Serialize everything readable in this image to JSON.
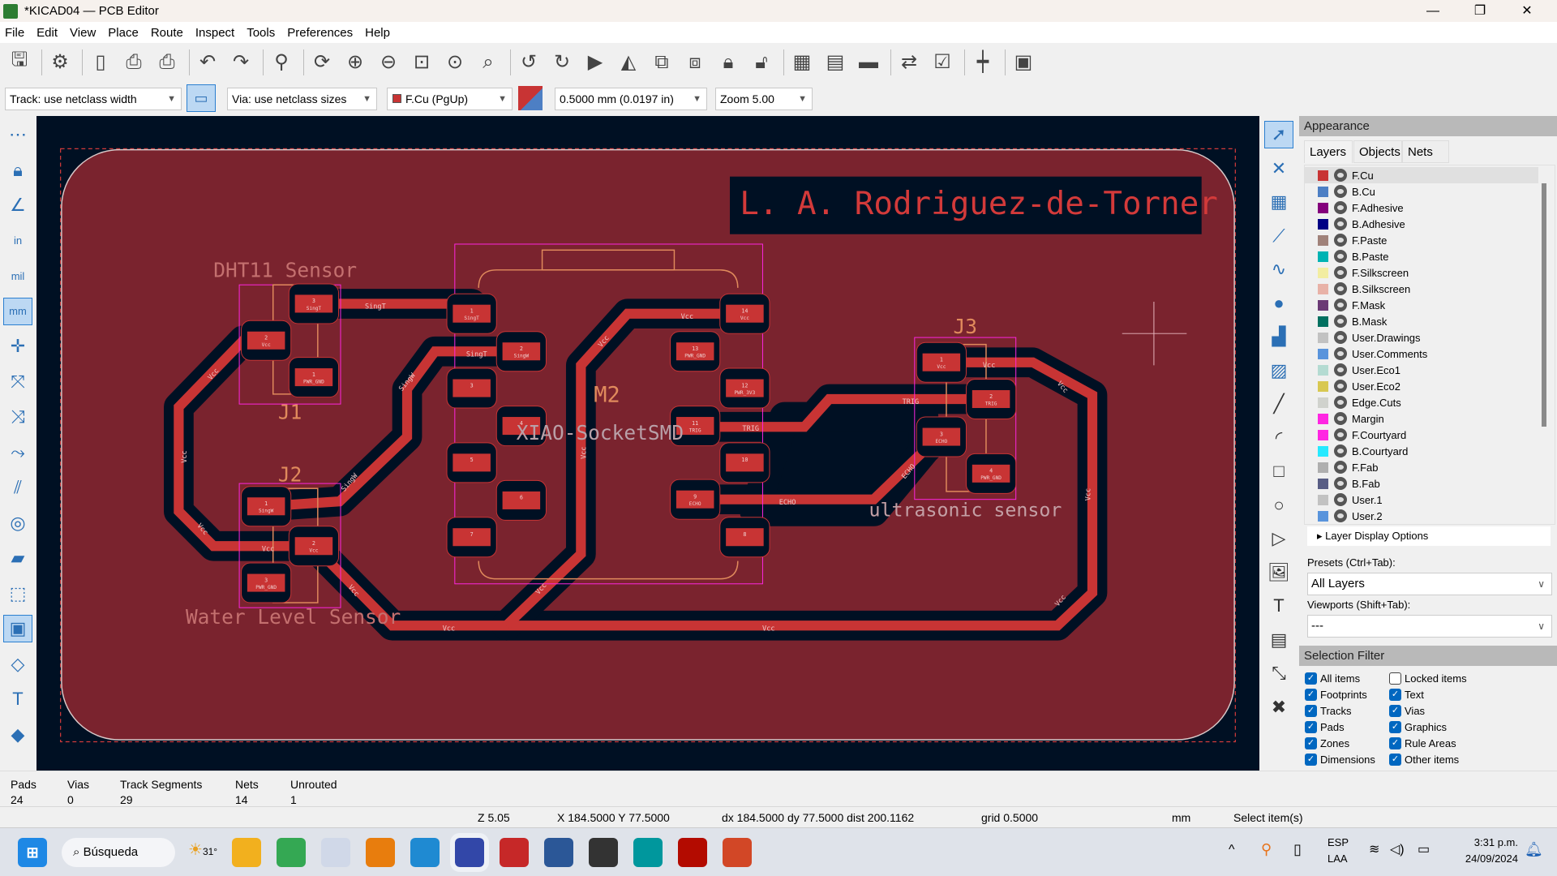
{
  "window": {
    "title": "*KICAD04 — PCB Editor",
    "controls": [
      "minimize",
      "restore",
      "close"
    ]
  },
  "menu": [
    "File",
    "Edit",
    "View",
    "Place",
    "Route",
    "Inspect",
    "Tools",
    "Preferences",
    "Help"
  ],
  "toolbar": [
    "save",
    "board-setup",
    "page-settings",
    "print",
    "plot",
    "undo",
    "redo",
    "find",
    "redraw",
    "zoom-in",
    "zoom-out",
    "zoom-fit",
    "zoom-objects",
    "zoom-selection",
    "rotate-ccw",
    "rotate-cw",
    "flip",
    "mirror",
    "group",
    "ungroup",
    "lock",
    "unlock",
    "netlist",
    "footprint-library",
    "footprint-editor",
    "update-pcb",
    "drc",
    "router",
    "scripting-console"
  ],
  "toolbar2": {
    "track": "Track: use netclass width",
    "via": "Via: use netclass sizes",
    "layer": "F.Cu (PgUp)",
    "layer_color": "#c83434",
    "grid": "0.5000 mm (0.0197 in)",
    "zoom": "Zoom 5.00"
  },
  "left_toolbar": [
    "grid",
    "lock-overrides",
    "polar-coordinates",
    "inches",
    "mils",
    "millimeters",
    "cursor",
    "ratsnest",
    "curved-ratsnest",
    "net-highlight",
    "track-outline",
    "via-outline",
    "zone-fill",
    "zone-outline",
    "pad-outline",
    "graphic-outline",
    "text-outline",
    "layer-contrast"
  ],
  "right_toolbar": [
    "select",
    "local-ratsnest",
    "add-footprint",
    "route-track",
    "tune-length",
    "add-via",
    "add-zone",
    "add-rule-area",
    "draw-line",
    "draw-arc",
    "draw-rectangle",
    "draw-circle",
    "draw-polygon",
    "add-image",
    "add-text",
    "add-textbox",
    "add-dimension",
    "delete"
  ],
  "pcb": {
    "title_text": "L. A. Rodriguez-de-Torner",
    "labels": {
      "dht11": "DHT11 Sensor",
      "j1": "J1",
      "j2": "J2",
      "water": "Water Level Sensor",
      "m2": "M2",
      "xiao": "XIAO-SocketSMD",
      "j3": "J3",
      "ultra": "ultrasonic sensor"
    },
    "track_labels": [
      "SingT",
      "SingW",
      "SingW",
      "SingW",
      "Vcc",
      "Vcc",
      "Vcc",
      "Vcc",
      "Vcc",
      "Vcc",
      "Vcc",
      "Vcc",
      "Vcc",
      "TRIG",
      "TRIG",
      "ECHO",
      "ECHO"
    ],
    "pads": [
      {
        "ref": "J1",
        "num": "3",
        "net": "SingT"
      },
      {
        "ref": "J1",
        "num": "2",
        "net": "Vcc"
      },
      {
        "ref": "J1",
        "num": "1",
        "net": "PWR_GND"
      },
      {
        "ref": "J2",
        "num": "1",
        "net": "SingW"
      },
      {
        "ref": "J2",
        "num": "2",
        "net": "Vcc"
      },
      {
        "ref": "J2",
        "num": "3",
        "net": "PWR_GND"
      },
      {
        "ref": "M2",
        "num": "1",
        "net": "SingT"
      },
      {
        "ref": "M2",
        "num": "2",
        "net": "SingW"
      },
      {
        "ref": "M2",
        "num": "3",
        "net": ""
      },
      {
        "ref": "M2",
        "num": "4",
        "net": ""
      },
      {
        "ref": "M2",
        "num": "5",
        "net": ""
      },
      {
        "ref": "M2",
        "num": "6",
        "net": ""
      },
      {
        "ref": "M2",
        "num": "7",
        "net": ""
      },
      {
        "ref": "M2",
        "num": "8",
        "net": ""
      },
      {
        "ref": "M2",
        "num": "9",
        "net": "ECHO"
      },
      {
        "ref": "M2",
        "num": "10",
        "net": ""
      },
      {
        "ref": "M2",
        "num": "11",
        "net": "TRIG"
      },
      {
        "ref": "M2",
        "num": "12",
        "net": "PWR_3V3"
      },
      {
        "ref": "M2",
        "num": "13",
        "net": "PWR_GND"
      },
      {
        "ref": "M2",
        "num": "14",
        "net": "Vcc"
      },
      {
        "ref": "J3",
        "num": "1",
        "net": "Vcc"
      },
      {
        "ref": "J3",
        "num": "2",
        "net": "TRIG"
      },
      {
        "ref": "J3",
        "num": "3",
        "net": "ECHO"
      },
      {
        "ref": "J3",
        "num": "4",
        "net": "PWR_GND"
      }
    ],
    "colors": {
      "board": "#7a232e",
      "copper": "#c83434",
      "background": "#001023",
      "courtyard": "#ff26e2",
      "fab": "#e08a5c",
      "silk": "#f2eda1"
    }
  },
  "appearance": {
    "title": "Appearance",
    "tabs": [
      "Layers",
      "Objects",
      "Nets"
    ],
    "active_tab": "Layers",
    "layers": [
      {
        "name": "F.Cu",
        "color": "#c83434"
      },
      {
        "name": "B.Cu",
        "color": "#4d7fc4"
      },
      {
        "name": "F.Adhesive",
        "color": "#84007c"
      },
      {
        "name": "B.Adhesive",
        "color": "#000084"
      },
      {
        "name": "F.Paste",
        "color": "#a0827a"
      },
      {
        "name": "B.Paste",
        "color": "#00b3b3"
      },
      {
        "name": "F.Silkscreen",
        "color": "#f2eda1"
      },
      {
        "name": "B.Silkscreen",
        "color": "#e8b2a7"
      },
      {
        "name": "F.Mask",
        "color": "#6b3a75"
      },
      {
        "name": "B.Mask",
        "color": "#027060"
      },
      {
        "name": "User.Drawings",
        "color": "#c2c2c2"
      },
      {
        "name": "User.Comments",
        "color": "#5994dc"
      },
      {
        "name": "User.Eco1",
        "color": "#b4dbd2"
      },
      {
        "name": "User.Eco2",
        "color": "#d8c852"
      },
      {
        "name": "Edge.Cuts",
        "color": "#d0d2cd"
      },
      {
        "name": "Margin",
        "color": "#ff26e2"
      },
      {
        "name": "F.Courtyard",
        "color": "#ff26e2"
      },
      {
        "name": "B.Courtyard",
        "color": "#26e9ff"
      },
      {
        "name": "F.Fab",
        "color": "#afafaf"
      },
      {
        "name": "B.Fab",
        "color": "#585d84"
      },
      {
        "name": "User.1",
        "color": "#c2c2c2"
      },
      {
        "name": "User.2",
        "color": "#5994dc"
      }
    ],
    "active_layer": "F.Cu",
    "layer_display_options": "Layer Display Options",
    "presets_label": "Presets (Ctrl+Tab):",
    "presets_value": "All Layers",
    "viewports_label": "Viewports (Shift+Tab):",
    "viewports_value": "---"
  },
  "selection_filter": {
    "title": "Selection Filter",
    "items": [
      {
        "label": "All items",
        "checked": true
      },
      {
        "label": "Locked items",
        "checked": false
      },
      {
        "label": "Footprints",
        "checked": true
      },
      {
        "label": "Text",
        "checked": true
      },
      {
        "label": "Tracks",
        "checked": true
      },
      {
        "label": "Vias",
        "checked": true
      },
      {
        "label": "Pads",
        "checked": true
      },
      {
        "label": "Graphics",
        "checked": true
      },
      {
        "label": "Zones",
        "checked": true
      },
      {
        "label": "Rule Areas",
        "checked": true
      },
      {
        "label": "Dimensions",
        "checked": true
      },
      {
        "label": "Other items",
        "checked": true
      }
    ]
  },
  "stats": [
    {
      "label": "Pads",
      "value": "24"
    },
    {
      "label": "Vias",
      "value": "0"
    },
    {
      "label": "Track Segments",
      "value": "29"
    },
    {
      "label": "Nets",
      "value": "14"
    },
    {
      "label": "Unrouted",
      "value": "1"
    }
  ],
  "statusbar": {
    "zoom": "Z 5.05",
    "coords": "X 184.5000  Y 77.5000",
    "delta": "dx 184.5000  dy 77.5000  dist 200.1162",
    "grid": "grid 0.5000",
    "units": "mm",
    "mode": "Select item(s)"
  },
  "taskbar": {
    "search": "Búsqueda",
    "weather": "31°",
    "apps": [
      "file-explorer",
      "chrome",
      "snipping-tool",
      "blender",
      "vscode",
      "kicad",
      "fusion",
      "word",
      "inkscape",
      "arduino",
      "acrobat",
      "powerpoint"
    ],
    "active_app": "kicad",
    "lang": "ESP",
    "lang2": "LAA",
    "time": "3:31 p.m.",
    "date": "24/09/2024"
  }
}
